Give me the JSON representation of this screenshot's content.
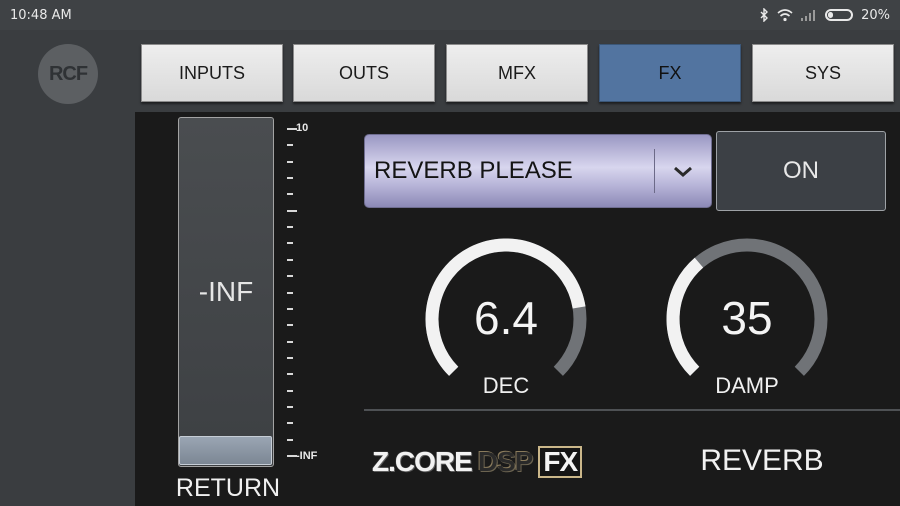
{
  "status_bar": {
    "time": "10:48 AM",
    "battery_percent": "20%",
    "battery_level": 0.2,
    "icons": [
      "bluetooth-icon",
      "wifi-icon",
      "cell-signal-icon",
      "battery-icon"
    ]
  },
  "logo": {
    "text": "RCF"
  },
  "tabs": [
    {
      "label": "INPUTS",
      "active": false
    },
    {
      "label": "OUTS",
      "active": false
    },
    {
      "label": "MFX",
      "active": false
    },
    {
      "label": "FX",
      "active": true
    },
    {
      "label": "SYS",
      "active": false
    }
  ],
  "return_fader": {
    "value": "-INF",
    "label": "RETURN",
    "scale_top": "10",
    "scale_bottom": "-INF",
    "level": 0.0
  },
  "preset": {
    "selected": "REVERB PLEASE",
    "dropdown_icon": "chevron-down-icon"
  },
  "on_button": {
    "label": "ON"
  },
  "knobs": {
    "dec": {
      "value": "6.4",
      "label": "DEC",
      "fraction": 0.8
    },
    "damp": {
      "value": "35",
      "label": "DAMP",
      "fraction": 0.35
    }
  },
  "brand": {
    "zcore": "Z.CORE",
    "dsp": "DSP",
    "fx": "FX"
  },
  "effect_name": "REVERB",
  "colors": {
    "active_tab": "#5274a0",
    "knob_fill": "#f2f2f2",
    "knob_track": "#707377",
    "panel_bg": "#1a1a1a"
  }
}
